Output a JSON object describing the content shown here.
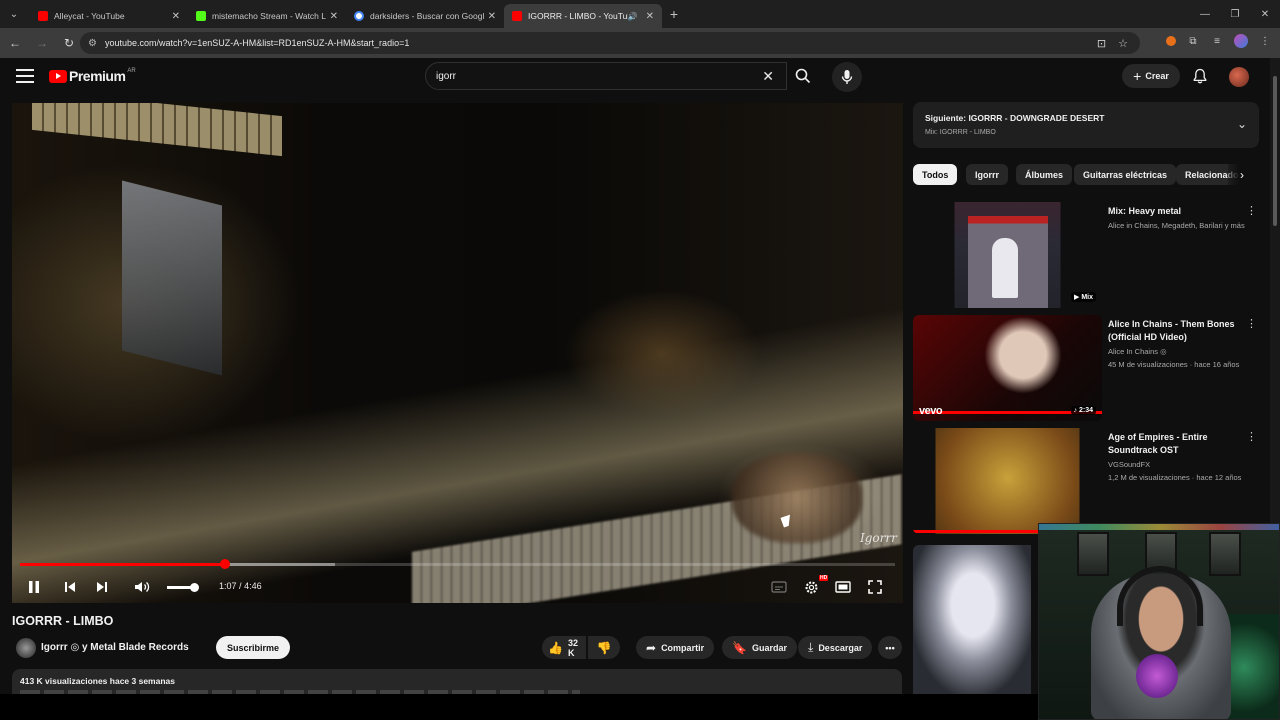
{
  "browser": {
    "tabs": [
      {
        "title": "Alleycat - YouTube",
        "favicon_color": "#ff0000",
        "active": false
      },
      {
        "title": "mistemacho Stream - Watch Liv",
        "favicon_color": "#53fc18",
        "active": false
      },
      {
        "title": "darksiders - Buscar con Google",
        "favicon_color": "#4285f4",
        "active": false
      },
      {
        "title": "IGORRR - LIMBO - YouTube",
        "favicon_color": "#ff0000",
        "active": true
      }
    ],
    "url": "youtube.com/watch?v=1enSUZ-A-HM&list=RD1enSUZ-A-HM&start_radio=1"
  },
  "header": {
    "logo_text": "Premium",
    "logo_country": "AR",
    "search_value": "igorr",
    "create_label": "Crear"
  },
  "player": {
    "time_current": "1:07",
    "time_separator": "/",
    "time_total": "4:46",
    "progress_fraction": 0.234,
    "buffered_fraction": 0.36,
    "volume_fraction": 0.9,
    "watermark": "Igorrr",
    "hd_badge": "HD"
  },
  "video": {
    "title": "IGORRR - LIMBO",
    "channel": "Igorrr ◎ y Metal Blade Records",
    "subscribe_label": "Suscribirme",
    "likes": "32 K",
    "share_label": "Compartir",
    "save_label": "Guardar",
    "download_label": "Descargar",
    "views_date": "413 K visualizaciones  hace 3 semanas"
  },
  "sidebar": {
    "next_title": "Siguiente: IGORRR - DOWNGRADE DESERT",
    "next_subtitle": "Mix: IGORRR - LIMBO",
    "chips": [
      "Todos",
      "Igorrr",
      "Álbumes",
      "Guitarras eléctricas",
      "Relacionado"
    ],
    "recommendations": [
      {
        "title": "Mix: Heavy metal",
        "line1": "Alice in Chains, Megadeth, Barilari y más",
        "line2": "",
        "badge": "▶ Mix"
      },
      {
        "title": "Alice In Chains - Them Bones (Official HD Video)",
        "line1": "Alice In Chains ◎",
        "line2": "45 M de visualizaciones · hace 16 años",
        "badge": "♪ 2:34",
        "label": "vevo"
      },
      {
        "title": "Age of Empires - Entire Soundtrack OST",
        "line1": "VGSoundFX",
        "line2": "1,2 M de visualizaciones · hace 12 años",
        "badge": ""
      }
    ]
  },
  "colors": {
    "youtube_red": "#ff0000",
    "background": "#0f0f0f",
    "chip_bg": "#272727"
  }
}
